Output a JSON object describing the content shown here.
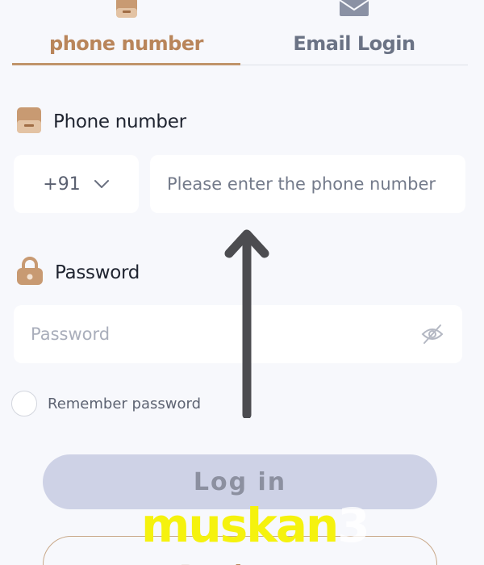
{
  "tabs": {
    "phone": {
      "label": "phone number",
      "icon": "phone-icon",
      "active": true
    },
    "email": {
      "label": "Email Login",
      "icon": "envelope-icon",
      "active": false
    }
  },
  "phone_section": {
    "title": "Phone number",
    "icon": "phone-icon",
    "country_code": "+91",
    "placeholder": "Please enter the phone number",
    "value": ""
  },
  "password_section": {
    "title": "Password",
    "icon": "lock-icon",
    "placeholder": "Password",
    "value": "",
    "visibility_icon": "eye-off-icon"
  },
  "remember": {
    "label": "Remember password",
    "checked": false
  },
  "buttons": {
    "login": "Log in",
    "register": "Register"
  },
  "overlay": {
    "arrow_icon": "arrow-up-icon",
    "watermark_main": "muskan",
    "watermark_suffix": "3"
  },
  "colors": {
    "accent": "#b9855a",
    "login_disabled": "#ced2e6",
    "watermark": "#f5f20e"
  }
}
